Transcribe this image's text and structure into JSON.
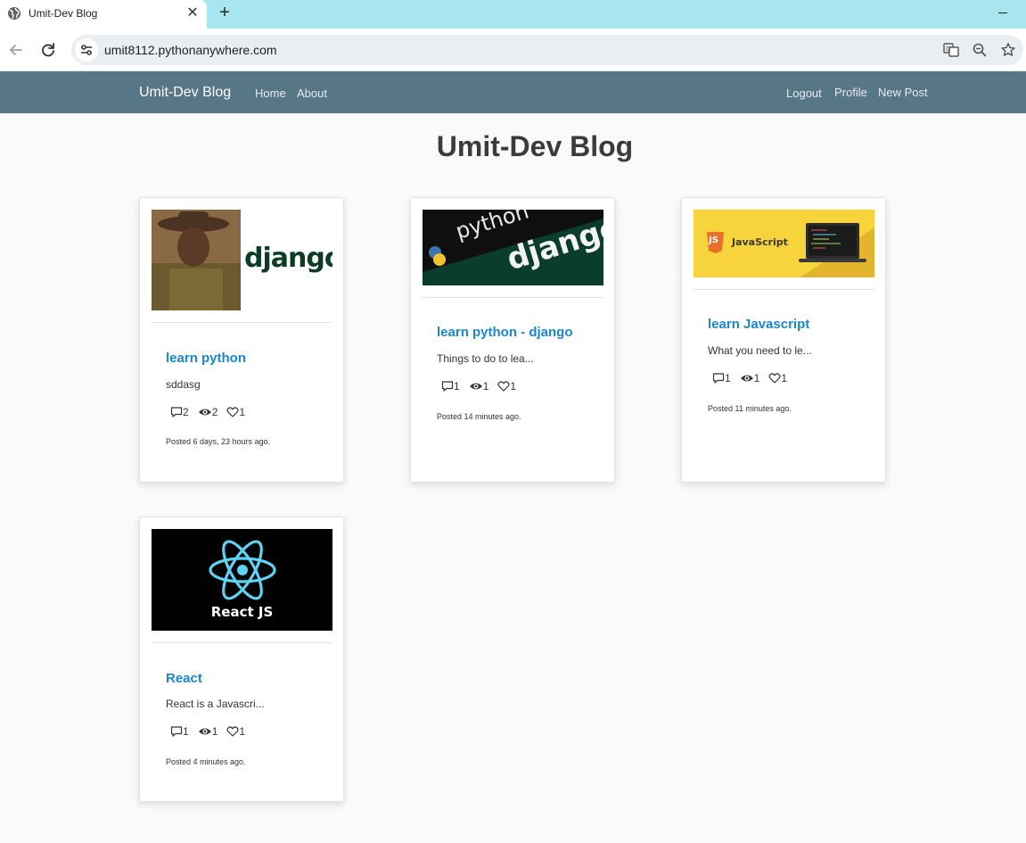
{
  "browser": {
    "tab_title": "Umit-Dev Blog",
    "tab_close": "✕",
    "new_tab": "+",
    "url": "umit8112.pythonanywhere.com"
  },
  "navbar": {
    "brand": "Umit-Dev Blog",
    "links": [
      "Home",
      "About"
    ],
    "right_links": [
      "Logout",
      "Profile",
      "New Post"
    ],
    "color": "#577686"
  },
  "page": {
    "title": "Umit-Dev Blog"
  },
  "posts": [
    {
      "title": "learn python",
      "excerpt": "sddasg",
      "comments": "2",
      "views": "2",
      "likes": "1",
      "posted": "Posted 6 days, 23 hours ago.",
      "image_text": "django"
    },
    {
      "title": "learn python - django",
      "excerpt": "Things to do to lea...",
      "comments": "1",
      "views": "1",
      "likes": "1",
      "posted": "Posted 14 minutes ago.",
      "image_text_1": "python",
      "image_text_2": "django"
    },
    {
      "title": "learn Javascript",
      "excerpt": "What you need to le...",
      "comments": "1",
      "views": "1",
      "likes": "1",
      "posted": "Posted 11 minutes ago.",
      "image_text": "JavaScript",
      "image_badge": "JS"
    },
    {
      "title": "React",
      "excerpt": "React is a Javascri...",
      "comments": "1",
      "views": "1",
      "likes": "1",
      "posted": "Posted 4 minutes ago.",
      "image_text": "React JS"
    }
  ],
  "colors": {
    "link": "#1a86cc",
    "tabbar": "#a8e6ef"
  }
}
